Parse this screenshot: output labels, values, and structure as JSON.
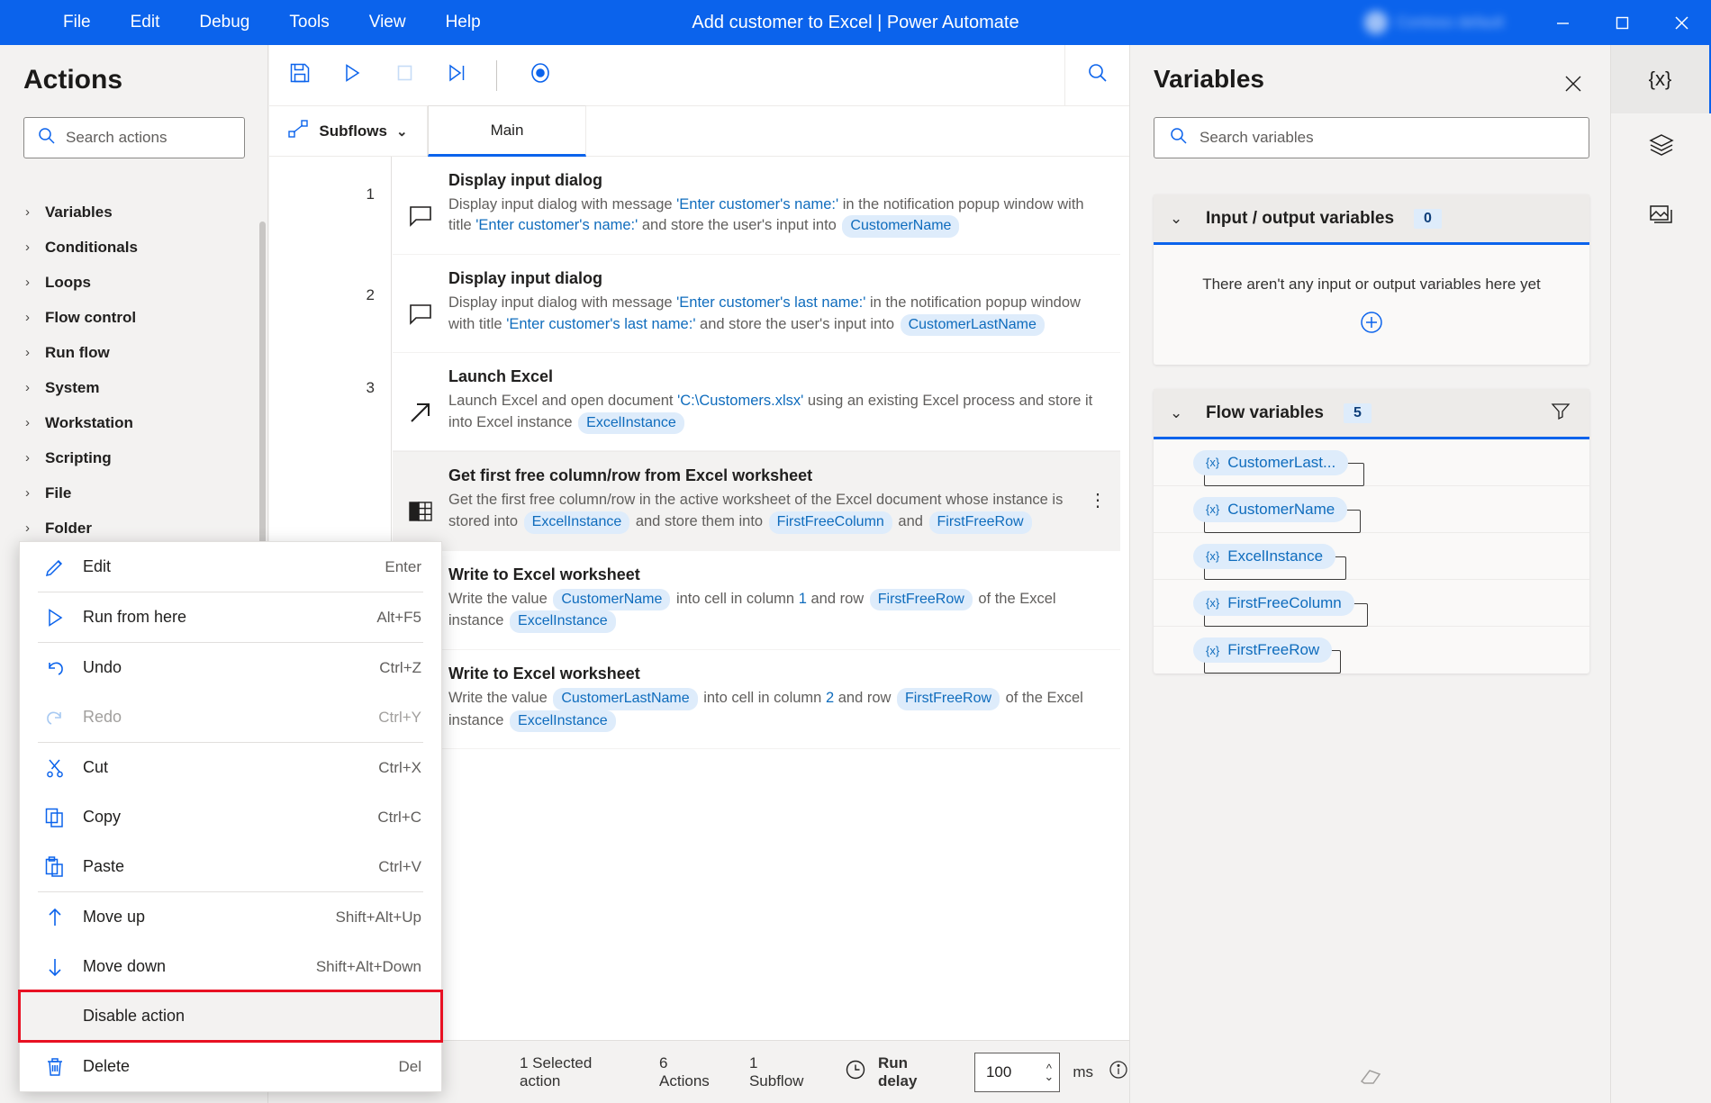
{
  "titlebar": {
    "menus": [
      "File",
      "Edit",
      "Debug",
      "Tools",
      "View",
      "Help"
    ],
    "title": "Add customer to Excel | Power Automate",
    "account_name": "Contoso default",
    "minimize": "minimize-button",
    "maximize": "maximize-button",
    "close": "close-button",
    "accent": "#0b63ec"
  },
  "actions_panel": {
    "title": "Actions",
    "search_placeholder": "Search actions",
    "groups": [
      {
        "label": "Variables"
      },
      {
        "label": "Conditionals"
      },
      {
        "label": "Loops"
      },
      {
        "label": "Flow control"
      },
      {
        "label": "Run flow"
      },
      {
        "label": "System"
      },
      {
        "label": "Workstation"
      },
      {
        "label": "Scripting"
      },
      {
        "label": "File"
      },
      {
        "label": "Folder"
      }
    ]
  },
  "toolbar": {
    "save": "save-icon",
    "run": "run-icon",
    "stop": "stop-icon",
    "run_next": "run-next-action-icon",
    "recorder": "recorder-icon",
    "search": "search-icon"
  },
  "tabs": {
    "subflows_label": "Subflows",
    "main_label": "Main"
  },
  "workspace": {
    "rows": [
      {
        "number": "1",
        "icon": "message-dialog-icon",
        "title": "Display input dialog",
        "selected": false,
        "desc": [
          {
            "t": "Display input dialog with message ",
            "k": "plain"
          },
          {
            "t": "'Enter customer's name:'",
            "k": "lit"
          },
          {
            "t": " in the notification popup window with title ",
            "k": "plain"
          },
          {
            "t": "'Enter customer's name:'",
            "k": "lit"
          },
          {
            "t": " and store the user's input into ",
            "k": "plain"
          },
          {
            "t": "CustomerName",
            "k": "pill"
          }
        ]
      },
      {
        "number": "2",
        "icon": "message-dialog-icon",
        "title": "Display input dialog",
        "selected": false,
        "desc": [
          {
            "t": "Display input dialog with message ",
            "k": "plain"
          },
          {
            "t": "'Enter customer's last name:'",
            "k": "lit"
          },
          {
            "t": " in the notification popup window with title ",
            "k": "plain"
          },
          {
            "t": "'Enter customer's last name:'",
            "k": "lit"
          },
          {
            "t": " and store the user's input into ",
            "k": "plain"
          },
          {
            "t": "CustomerLastName",
            "k": "pill"
          }
        ]
      },
      {
        "number": "3",
        "icon": "launch-excel-icon",
        "title": "Launch Excel",
        "selected": false,
        "desc": [
          {
            "t": "Launch Excel and open document ",
            "k": "plain"
          },
          {
            "t": "'C:\\Customers.xlsx'",
            "k": "lit"
          },
          {
            "t": " using an existing Excel process and store it into Excel instance ",
            "k": "plain"
          },
          {
            "t": "ExcelInstance",
            "k": "pill"
          }
        ]
      },
      {
        "number": "",
        "icon": "excel-worksheet-icon",
        "title": "Get first free column/row from Excel worksheet",
        "selected": true,
        "kebab": "more-options-icon",
        "desc": [
          {
            "t": "Get the first free column/row in the active worksheet of the Excel document whose instance is stored into ",
            "k": "plain"
          },
          {
            "t": "ExcelInstance",
            "k": "pill"
          },
          {
            "t": " and store them into ",
            "k": "plain"
          },
          {
            "t": "FirstFreeColumn",
            "k": "pill"
          },
          {
            "t": " and ",
            "k": "plain"
          },
          {
            "t": "FirstFreeRow",
            "k": "pill"
          }
        ]
      },
      {
        "number": "",
        "icon": "excel-worksheet-icon",
        "title": "Write to Excel worksheet",
        "selected": false,
        "desc": [
          {
            "t": "Write the value ",
            "k": "plain"
          },
          {
            "t": "CustomerName",
            "k": "pill"
          },
          {
            "t": " into cell in column ",
            "k": "plain"
          },
          {
            "t": "1",
            "k": "lit"
          },
          {
            "t": " and row ",
            "k": "plain"
          },
          {
            "t": "FirstFreeRow",
            "k": "pill"
          },
          {
            "t": " of the Excel instance ",
            "k": "plain"
          },
          {
            "t": "ExcelInstance",
            "k": "pill"
          }
        ]
      },
      {
        "number": "",
        "icon": "excel-worksheet-icon",
        "title": "Write to Excel worksheet",
        "selected": false,
        "desc": [
          {
            "t": "Write the value ",
            "k": "plain"
          },
          {
            "t": "CustomerLastName",
            "k": "pill"
          },
          {
            "t": " into cell in column ",
            "k": "plain"
          },
          {
            "t": "2",
            "k": "lit"
          },
          {
            "t": " and row ",
            "k": "plain"
          },
          {
            "t": "FirstFreeRow",
            "k": "pill"
          },
          {
            "t": " of the Excel instance ",
            "k": "plain"
          },
          {
            "t": "ExcelInstance",
            "k": "pill"
          }
        ]
      }
    ]
  },
  "context_menu": {
    "items": [
      {
        "label": "Edit",
        "shortcut": "Enter",
        "icon": "pencil-icon",
        "state": "normal",
        "separator_after": true
      },
      {
        "label": "Run from here",
        "shortcut": "Alt+F5",
        "icon": "play-icon",
        "state": "normal",
        "separator_after": true
      },
      {
        "label": "Undo",
        "shortcut": "Ctrl+Z",
        "icon": "undo-icon",
        "state": "normal",
        "separator_after": false
      },
      {
        "label": "Redo",
        "shortcut": "Ctrl+Y",
        "icon": "redo-icon",
        "state": "disabled",
        "separator_after": true
      },
      {
        "label": "Cut",
        "shortcut": "Ctrl+X",
        "icon": "scissors-icon",
        "state": "normal",
        "separator_after": false
      },
      {
        "label": "Copy",
        "shortcut": "Ctrl+C",
        "icon": "copy-icon",
        "state": "normal",
        "separator_after": false
      },
      {
        "label": "Paste",
        "shortcut": "Ctrl+V",
        "icon": "paste-icon",
        "state": "normal",
        "separator_after": true
      },
      {
        "label": "Move up",
        "shortcut": "Shift+Alt+Up",
        "icon": "arrow-up-icon",
        "state": "normal",
        "separator_after": false
      },
      {
        "label": "Move down",
        "shortcut": "Shift+Alt+Down",
        "icon": "arrow-down-icon",
        "state": "normal",
        "separator_after": false
      },
      {
        "label": "Disable action",
        "shortcut": "",
        "icon": "",
        "state": "highlighted",
        "separator_after": true
      },
      {
        "label": "Delete",
        "shortcut": "Del",
        "icon": "trash-icon",
        "state": "normal",
        "separator_after": false
      }
    ],
    "highlight_color": "#e81123"
  },
  "variables_panel": {
    "title": "Variables",
    "close": "close-panel-icon",
    "search_placeholder": "Search variables",
    "io_group": {
      "label": "Input / output variables",
      "count": "0",
      "empty_text": "There aren't any input or output variables here yet",
      "add": "add-variable-icon"
    },
    "flow_group": {
      "label": "Flow variables",
      "count": "5",
      "filter": "filter-icon",
      "variables": [
        {
          "name": "CustomerLast...",
          "prefix": "{x}"
        },
        {
          "name": "CustomerName",
          "prefix": "{x}"
        },
        {
          "name": "ExcelInstance",
          "prefix": "{x}"
        },
        {
          "name": "FirstFreeColumn",
          "prefix": "{x}"
        },
        {
          "name": "FirstFreeRow",
          "prefix": "{x}"
        }
      ]
    },
    "eraser": "eraser-icon"
  },
  "rail": {
    "buttons": [
      {
        "icon": "variables-braces-icon",
        "label": "{x}",
        "active": true
      },
      {
        "icon": "layers-icon",
        "label": "",
        "active": false
      },
      {
        "icon": "images-icon",
        "label": "",
        "active": false
      }
    ]
  },
  "statusbar": {
    "selected_actions": "1 Selected action",
    "actions_count": "6 Actions",
    "subflows_count": "1 Subflow",
    "run_delay_icon": "clock-icon",
    "run_delay_label": "Run delay",
    "run_delay_value": "100",
    "unit": "ms",
    "info_icon": "info-icon"
  }
}
